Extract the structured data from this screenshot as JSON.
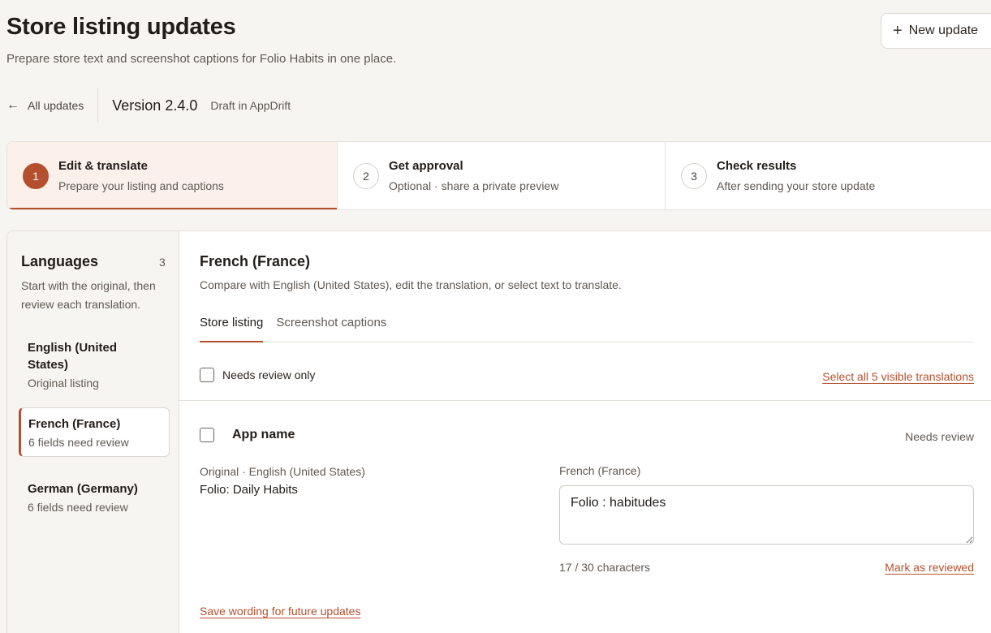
{
  "header": {
    "title": "Store listing updates",
    "subtitle": "Prepare store text and screenshot captions for Folio Habits in one place.",
    "new_update_label": "New update"
  },
  "breadcrumb": {
    "back_label": "All updates",
    "version": "Version 2.4.0",
    "status": "Draft in AppDrift"
  },
  "steps": [
    {
      "number": "1",
      "title": "Edit & translate",
      "description": "Prepare your listing and captions",
      "active": true
    },
    {
      "number": "2",
      "title": "Get approval",
      "description": "Optional · share a private preview",
      "active": false
    },
    {
      "number": "3",
      "title": "Check results",
      "description": "After sending your store update",
      "active": false
    }
  ],
  "sidebar": {
    "title": "Languages",
    "count": "3",
    "help": "Start with the original, then review each translation.",
    "items": [
      {
        "name": "English (United States)",
        "status": "Original listing"
      },
      {
        "name": "French (France)",
        "status": "6 fields need review"
      },
      {
        "name": "German (Germany)",
        "status": "6 fields need review"
      }
    ]
  },
  "main": {
    "title": "French (France)",
    "description": "Compare with English (United States), edit the translation, or select text to translate.",
    "tabs": [
      {
        "label": "Store listing"
      },
      {
        "label": "Screenshot captions"
      }
    ],
    "filter_label": "Needs review only",
    "select_all_label": "Select all 5 visible translations",
    "field": {
      "name": "App name",
      "status": "Needs review",
      "original_label": "Original · English (United States)",
      "original_value": "Folio: Daily Habits",
      "translation_label": "French (France)",
      "translation_value": "Folio : habitudes",
      "char_count": "17 / 30 characters",
      "mark_reviewed_label": "Mark as reviewed",
      "save_wording_label": "Save wording for future updates"
    }
  },
  "colors": {
    "accent": "#b5502f",
    "background": "#f7f5f2",
    "active_step_bg": "#fcf0eb"
  },
  "icons": {
    "new_update": "plus-icon",
    "back": "arrow-left-icon"
  }
}
